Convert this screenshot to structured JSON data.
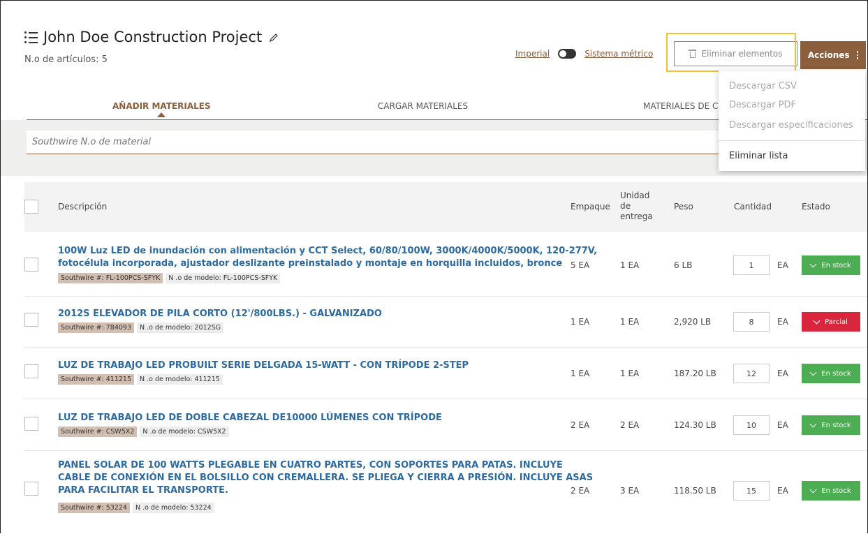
{
  "header": {
    "title": "John Doe Construction Project",
    "item_count": "N.o de artículos: 5"
  },
  "units": {
    "imperial": "Imperial",
    "metric": "Sistema métrico"
  },
  "toolbar": {
    "delete_label": "Eliminar elementos",
    "actions_label": "Acciones"
  },
  "tabs": [
    "AÑADIR MATERIALES",
    "CARGAR MATERIALES",
    "MATERIALES DE CO"
  ],
  "search": {
    "placeholder": "Southwire N.o de material"
  },
  "actions_menu": [
    "Descargar CSV",
    "Descargar PDF",
    "Descargar especificaciones",
    "Eliminar lista"
  ],
  "table": {
    "headers": {
      "description": "Descripción",
      "package": "Empaque",
      "unit_line1": "Unidad",
      "unit_line2": "de",
      "unit_line3": "entrega",
      "weight": "Peso",
      "quantity": "Cantidad",
      "status": "Estado"
    },
    "rows": [
      {
        "desc1": "100W Luz LED de inundación con alimentación y CCT Select, 60/80/100W, 3000K/4000K/5000K, 120-277V,",
        "desc2": "fotocélula incorporada, ajustador deslizante preinstalado y montaje en horquilla incluidos, bronce",
        "sw": "Southwire #: FL-100PCS-SFYK",
        "model": "N .o de modelo: FL-100PCS-SFYK",
        "package": "5 EA",
        "unit": "1 EA",
        "weight": "6 LB",
        "qty": "1",
        "qty_unit": "EA",
        "status": "En stock"
      },
      {
        "desc1": "2012S ELEVADOR DE PILA CORTO (12'/800LBS.) - GALVANIZADO",
        "sw": "Southwire #: 784093",
        "model": "N .o de modelo: 2012SG",
        "package": "1 EA",
        "unit": "1 EA",
        "weight": "2,920 LB",
        "qty": "8",
        "qty_unit": "EA",
        "status": "Parcial"
      },
      {
        "desc1": "LUZ DE TRABAJO LED PROBUILT SERIE DELGADA 15-WATT - CON TRÍPODE 2-STEP",
        "sw": "Southwire #: 411215",
        "model": "N .o de modelo: 411215",
        "package": "1 EA",
        "unit": "1 EA",
        "weight": "187.20 LB",
        "qty": "12",
        "qty_unit": "EA",
        "status": "En stock"
      },
      {
        "desc1": "LUZ DE TRABAJO LED DE DOBLE CABEZAL DE10000 LÚMENES CON TRÍPODE",
        "sw": "Southwire #: CSW5X2",
        "model": "N .o de modelo: CSW5X2",
        "package": "2 EA",
        "unit": "2 EA",
        "weight": "124.30 LB",
        "qty": "10",
        "qty_unit": "EA",
        "status": "En stock"
      },
      {
        "desc1": "PANEL SOLAR DE 100 WATTS PLEGABLE EN CUATRO PARTES, CON SOPORTES PARA PATAS. INCLUYE",
        "desc2": "CABLE DE CONEXIÓN EN EL BOLSILLO CON CREMALLERA. SE PLIEGA Y CIERRA A PRESIÓN. INCLUYE ASAS",
        "desc3": "PARA FACILITAR EL TRANSPORTE.",
        "sw": "Southwire #: 53224",
        "model": "N .o de modelo: 53224",
        "package": "2 EA",
        "unit": "3 EA",
        "weight": "118.50 LB",
        "qty": "15",
        "qty_unit": "EA",
        "status": "En stock"
      }
    ]
  },
  "colors": {
    "brand": "#8b5e3c",
    "link": "#2d6a9f",
    "in_stock": "#4cad52",
    "partial": "#d9263d",
    "highlight": "#f2c12e"
  }
}
